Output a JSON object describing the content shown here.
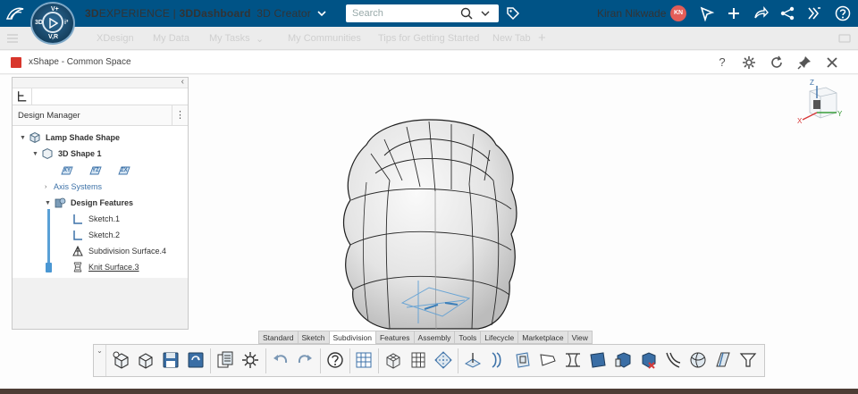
{
  "topbar": {
    "brand_prefix": "3D",
    "brand_experience": "EXPERIENCE",
    "brand_sep": " | ",
    "brand_dashboard": "3DDashboard",
    "brand_role": "3D Creator",
    "search": {
      "placeholder": "Search",
      "value": ""
    },
    "user_name": "Kiran Nikwade",
    "user_initials": "KN",
    "compass_labels": {
      "top": "V+",
      "left": "3D",
      "right": "i³",
      "bottom": "V,R"
    }
  },
  "tabbar": {
    "tabs": [
      "XDesign",
      "My Data",
      "My Tasks",
      "My Communities",
      "Tips for Getting Started",
      "New Tab"
    ]
  },
  "widget": {
    "title": "xShape - Common Space"
  },
  "design_manager": {
    "label": "Design Manager",
    "tree": {
      "root": "Lamp Shade Shape",
      "shape": "3D Shape 1",
      "planes": [
        "XY",
        "YZ",
        "ZX"
      ],
      "axis_systems": "Axis Systems",
      "design_features": "Design Features",
      "features": [
        "Sketch.1",
        "Sketch.2",
        "Subdivision Surface.4",
        "Knit Surface.3"
      ]
    }
  },
  "viewcube": {
    "x": "X",
    "y": "Y",
    "z": "Z"
  },
  "toolbar": {
    "tabs": [
      "Standard",
      "Sketch",
      "Subdivision",
      "Features",
      "Assembly",
      "Tools",
      "Lifecycle",
      "Marketplace",
      "View"
    ],
    "active_tab": "Subdivision"
  },
  "colors": {
    "topbar": "#005386",
    "accent": "#4a97d3",
    "avatar": "#e35d58"
  }
}
